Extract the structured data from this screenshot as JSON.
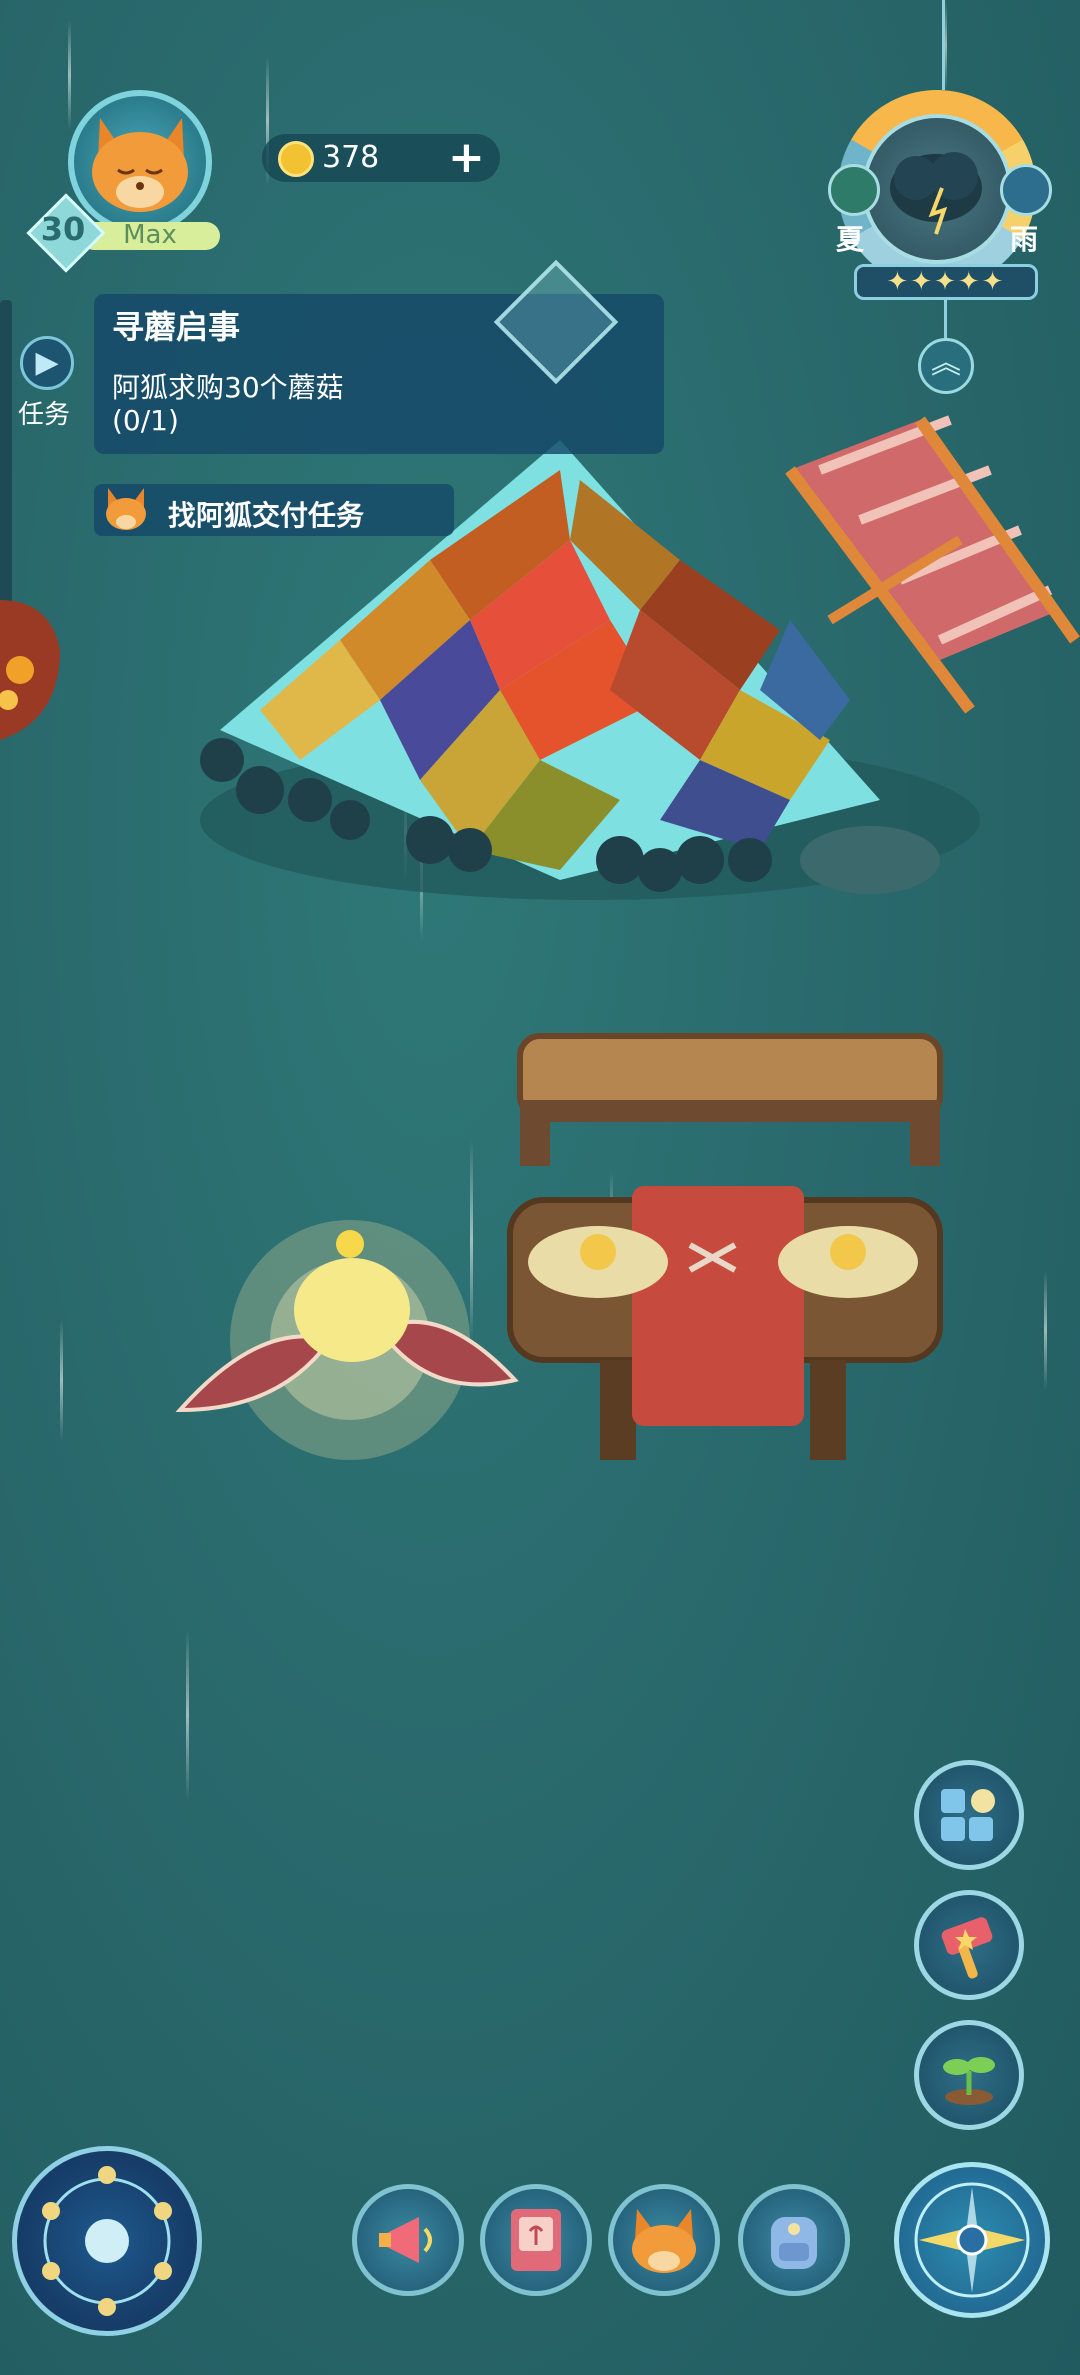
{
  "player": {
    "level": "30",
    "level_status": "Max"
  },
  "currency": {
    "coins": "378",
    "add_label": "+"
  },
  "weather": {
    "season": "夏",
    "condition": "雨",
    "stars": "✦✦✦✦✦",
    "stars_count": 5
  },
  "quest": {
    "tab_label": "任务",
    "title": "寻蘑启事",
    "description": "阿狐求购30个蘑菇",
    "progress": "(0/1)",
    "sub_task": "找阿狐交付任务"
  },
  "colors": {
    "background": "#2a6b6e",
    "panel": "#154868",
    "accent": "#9ed7e4"
  },
  "right_buttons": [
    "puzzle-icon",
    "hammer-icon",
    "sprout-icon"
  ],
  "bottom_buttons": [
    "megaphone-icon",
    "book-icon",
    "fox-icon",
    "backpack-icon"
  ]
}
